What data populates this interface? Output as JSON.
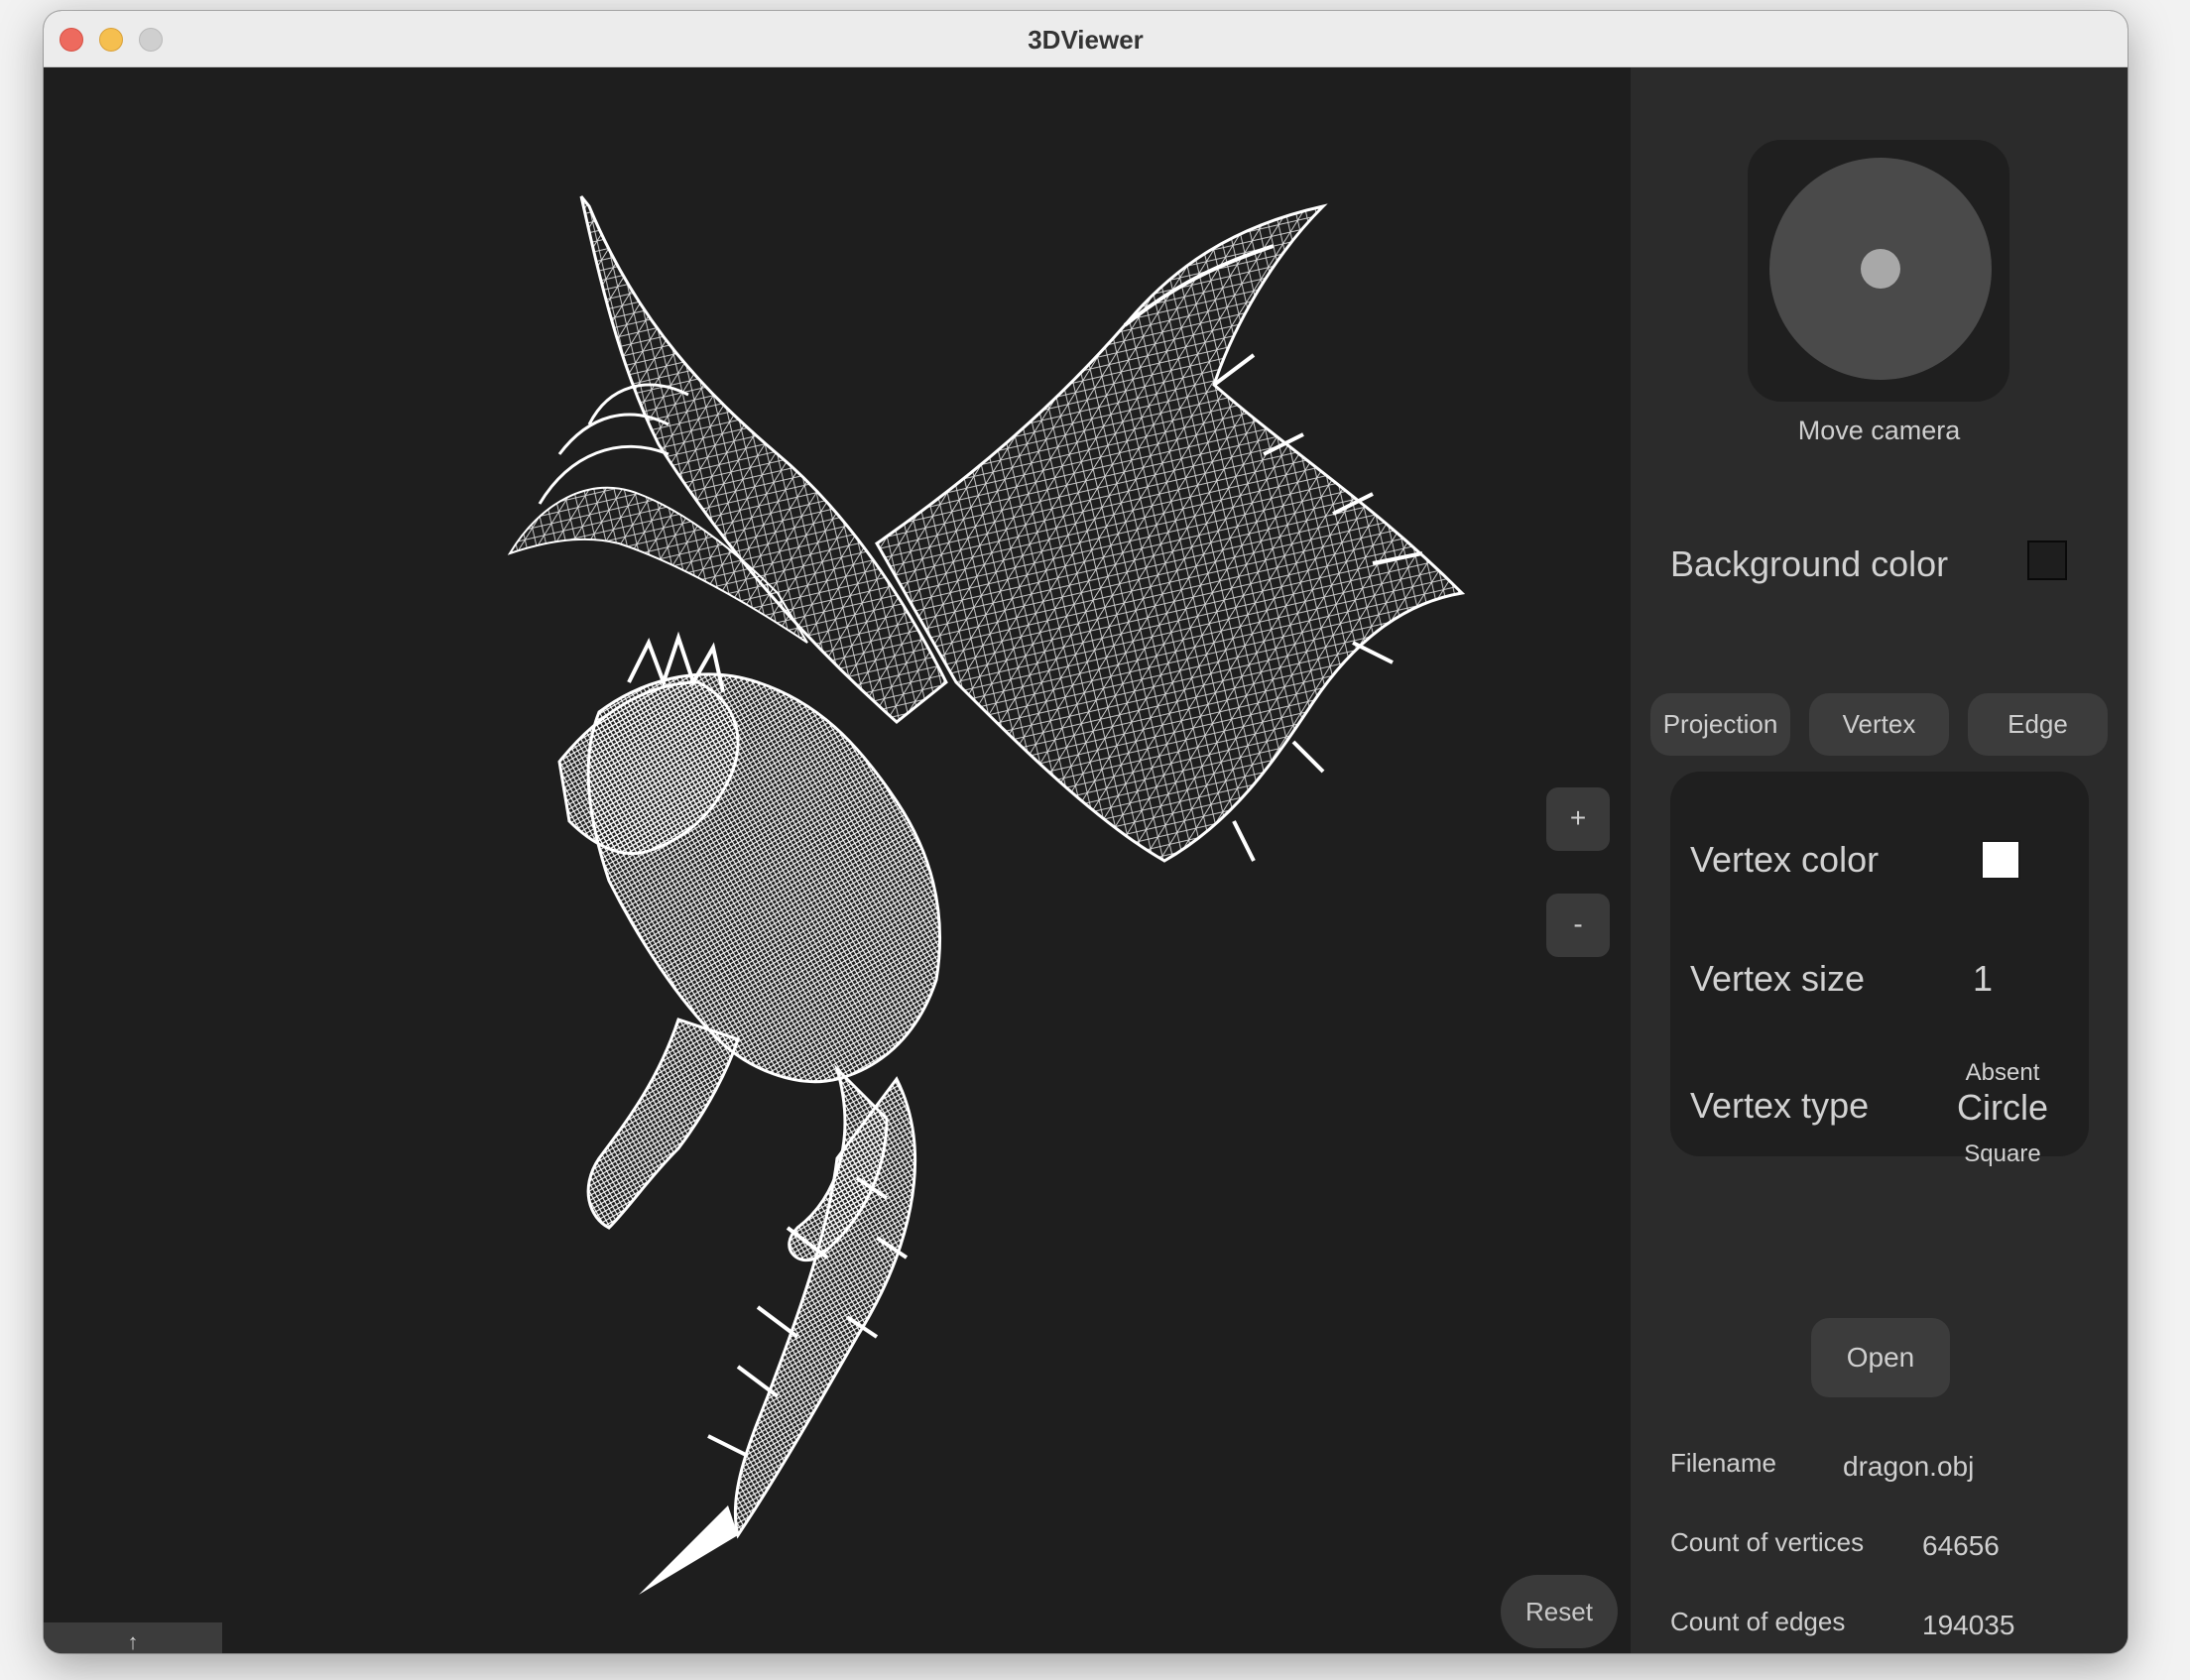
{
  "window": {
    "title": "3DViewer"
  },
  "viewport": {
    "zoom_in_label": "+",
    "zoom_out_label": "-",
    "reset_label": "Reset",
    "collapse_label": "↑",
    "model_name": "dragon wireframe"
  },
  "camera": {
    "label": "Move camera"
  },
  "background": {
    "label": "Background color",
    "color": "#1e1e1e"
  },
  "tabs": [
    {
      "label": "Projection"
    },
    {
      "label": "Vertex"
    },
    {
      "label": "Edge"
    }
  ],
  "vertex": {
    "color_label": "Vertex color",
    "color": "#ffffff",
    "size_label": "Vertex size",
    "size_value": "1",
    "type_label": "Vertex type",
    "type_options": [
      "Absent",
      "Circle",
      "Square"
    ],
    "selected_type": "Circle"
  },
  "file": {
    "open_label": "Open",
    "filename_label": "Filename",
    "filename": "dragon.obj",
    "vertices_label": "Count of vertices",
    "vertices": "64656",
    "edges_label": "Count of edges",
    "edges": "194035"
  }
}
